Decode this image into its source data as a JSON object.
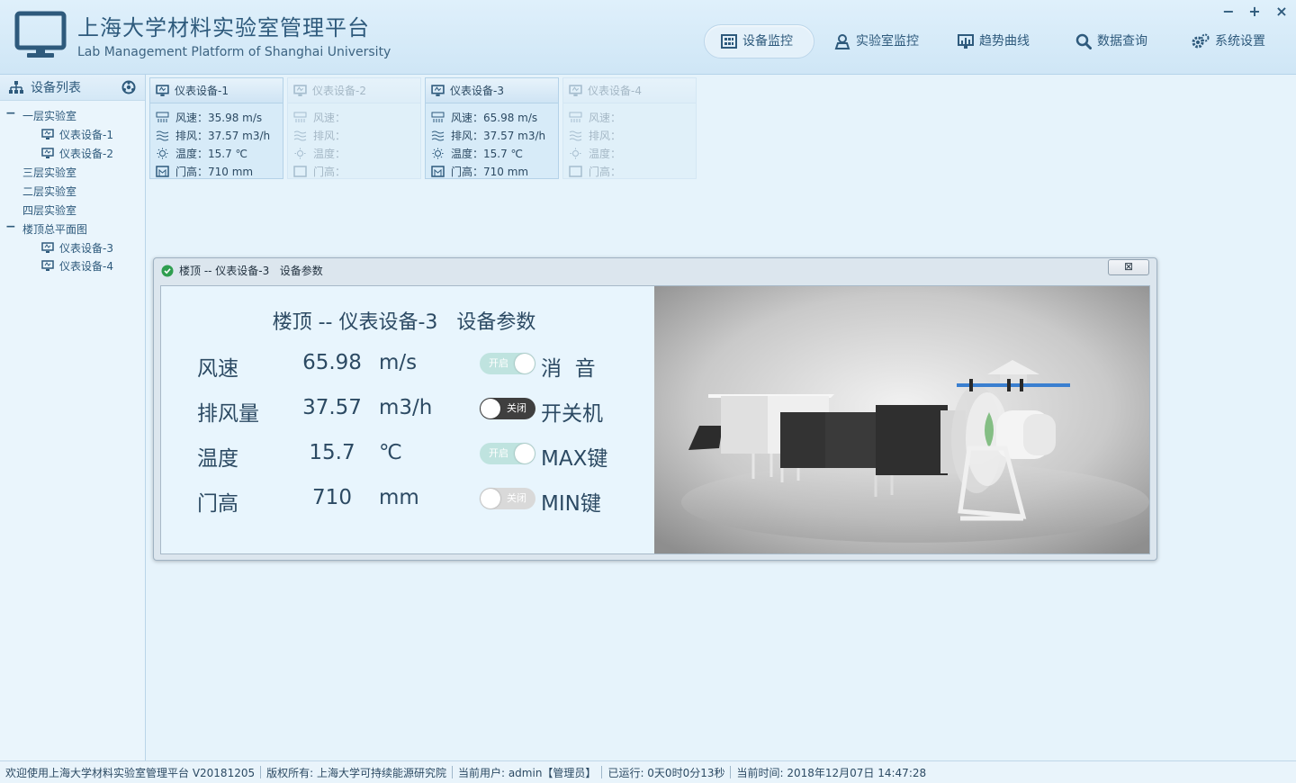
{
  "header": {
    "title": "上海大学材料实验室管理平台",
    "subtitle": "Lab Management Platform of Shanghai University",
    "window_controls": [
      "−",
      "+",
      "×"
    ]
  },
  "nav": {
    "items": [
      {
        "label": "设备监控",
        "icon": "grid-icon",
        "active": true
      },
      {
        "label": "实验室监控",
        "icon": "user-pin-icon",
        "active": false
      },
      {
        "label": "趋势曲线",
        "icon": "chart-icon",
        "active": false
      },
      {
        "label": "数据查询",
        "icon": "search-icon",
        "active": false
      },
      {
        "label": "系统设置",
        "icon": "gear-icon",
        "active": false
      }
    ]
  },
  "sidebar": {
    "title": "设备列表",
    "tree": [
      {
        "label": "一层实验室",
        "expanded": true,
        "children": [
          "仪表设备-1",
          "仪表设备-2"
        ]
      },
      {
        "label": "三层实验室"
      },
      {
        "label": "二层实验室"
      },
      {
        "label": "四层实验室"
      },
      {
        "label": "楼顶总平面图",
        "expanded": true,
        "children": [
          "仪表设备-3",
          "仪表设备-4"
        ]
      }
    ],
    "collapse_symbol": "−"
  },
  "cards": [
    {
      "title": "仪表设备-1",
      "enabled": true,
      "rows": [
        "风速：35.98 m/s",
        "排风：37.57 m3/h",
        "温度：15.7 ℃",
        "门高：710 mm"
      ]
    },
    {
      "title": "仪表设备-2",
      "enabled": false,
      "rows": [
        "风速：",
        "排风：",
        "温度：",
        "门高："
      ]
    },
    {
      "title": "仪表设备-3",
      "enabled": true,
      "rows": [
        "风速：65.98 m/s",
        "排风：37.57 m3/h",
        "温度：15.7 ℃",
        "门高：710 mm"
      ]
    },
    {
      "title": "仪表设备-4",
      "enabled": false,
      "rows": [
        "风速：",
        "排风：",
        "温度：",
        "门高："
      ]
    }
  ],
  "dialog": {
    "title": "楼顶 -- 仪表设备-3   设备参数",
    "close_label": "⊠",
    "heading": "楼顶 -- 仪表设备-3   设备参数",
    "params": [
      {
        "label": "风速",
        "value": "65.98",
        "unit": "m/s"
      },
      {
        "label": "排风量",
        "value": "37.57",
        "unit": "m3/h"
      },
      {
        "label": "温度",
        "value": "15.7",
        "unit": "℃"
      },
      {
        "label": "门高",
        "value": "710",
        "unit": "mm"
      }
    ],
    "toggles": [
      {
        "state_text": "开启",
        "caption": "消  音",
        "state": "on"
      },
      {
        "state_text": "关闭",
        "caption": "开关机",
        "state": "off-dark"
      },
      {
        "state_text": "开启",
        "caption": "MAX键",
        "state": "on"
      },
      {
        "state_text": "关闭",
        "caption": "MIN键",
        "state": "off-light"
      }
    ]
  },
  "statusbar": {
    "welcome": "欢迎使用上海大学材料实验室管理平台 V20181205",
    "copyright": "版权所有: 上海大学可持续能源研究院",
    "user": "当前用户: admin【管理员】",
    "uptime": "已运行: 0天0时0分13秒",
    "time": "当前时间: 2018年12月07日 14:47:28"
  },
  "colors": {
    "accent": "#2e5a7c",
    "background": "#e6f3fb",
    "toggle_on": "#bfe3df",
    "toggle_off_dark": "#3f3f3f"
  }
}
